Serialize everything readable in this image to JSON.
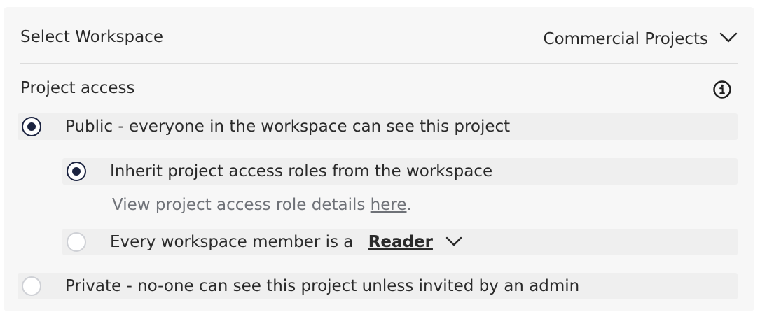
{
  "workspace": {
    "label": "Select Workspace",
    "selected": "Commercial Projects",
    "dropdown_icon": "chevron-down-icon"
  },
  "access": {
    "label": "Project access",
    "info_icon": "info-icon",
    "options": {
      "public": {
        "label": "Public - everyone in the workspace can see this project",
        "selected": true
      },
      "private": {
        "label": "Private - no-one can see this project unless invited by an admin",
        "selected": false
      }
    },
    "sub_options": {
      "inherit": {
        "label": "Inherit project access roles from the workspace",
        "selected": true,
        "hint_prefix": "View project access role details ",
        "hint_link": "here",
        "hint_suffix": "."
      },
      "member_role": {
        "label_prefix": "Every workspace member is a",
        "role": "Reader",
        "selected": false
      }
    }
  },
  "colors": {
    "radio_selected": "#1b2340",
    "radio_unselected_border": "#cfd1d6",
    "panel_bg": "#f7f7f7",
    "row_bg": "#efefef",
    "hint_text": "#6f7278"
  }
}
